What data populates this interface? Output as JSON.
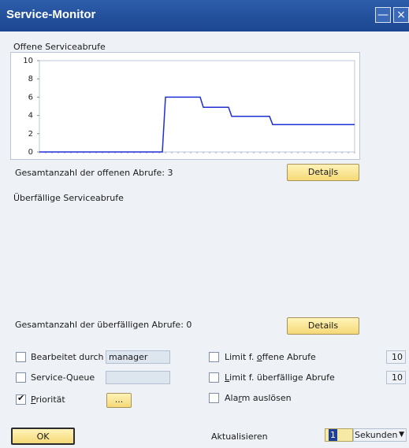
{
  "window": {
    "title": "Service-Monitor"
  },
  "open_calls": {
    "heading": "Offene Serviceabrufe",
    "total_label": "Gesamtanzahl der offenen Abrufe: 3",
    "details_label": "Details"
  },
  "chart_data": {
    "type": "line",
    "title": "",
    "xlabel": "",
    "ylabel": "",
    "ylim": [
      0,
      10
    ],
    "yticks": [
      "0",
      "2",
      "4",
      "6",
      "8",
      "10"
    ],
    "grid": false,
    "series": [
      {
        "points": [
          [
            0.0,
            0
          ],
          [
            0.39,
            0
          ],
          [
            0.4,
            6
          ],
          [
            0.51,
            6
          ],
          [
            0.52,
            4.9
          ],
          [
            0.6,
            4.9
          ],
          [
            0.61,
            3.9
          ],
          [
            0.73,
            3.9
          ],
          [
            0.74,
            3
          ],
          [
            1.0,
            3
          ]
        ]
      }
    ],
    "colors": {
      "line": "#1f2fd6",
      "axis": "#b9c7d8"
    }
  },
  "overdue_calls": {
    "heading": "Überfällige Serviceabrufe",
    "total_label": "Gesamtanzahl der überfälligen Abrufe: 0",
    "details_label": "Details"
  },
  "filters": {
    "processed_by": {
      "label": "Bearbeitet durch",
      "value": "manager",
      "checked": false
    },
    "service_queue": {
      "label": "Service-Queue",
      "value": "",
      "checked": false
    },
    "priority": {
      "label": "Priorität",
      "checked": true,
      "button_label": "..."
    }
  },
  "limits": {
    "open_limit": {
      "label": "Limit f. offene Abrufe",
      "value": "10",
      "checked": false
    },
    "overdue_limit": {
      "label": "Limit f. überfällige Abrufe",
      "value": "10",
      "checked": false
    },
    "alarm": {
      "label": "Alarm auslösen",
      "checked": false
    }
  },
  "footer": {
    "ok_label": "OK",
    "refresh_label": "Aktualisieren",
    "refresh_value": "1",
    "unit_value": "Sekunden"
  }
}
